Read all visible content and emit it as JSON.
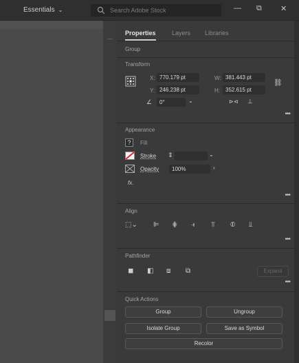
{
  "topbar": {
    "workspace_label": "Essentials",
    "search_placeholder": "Search Adobe Stock",
    "minimize": "—",
    "restore": "⧉",
    "close": "✕"
  },
  "panel": {
    "tabs": [
      "Properties",
      "Layers",
      "Libraries"
    ],
    "object_type": "Group",
    "transform": {
      "title": "Transform",
      "x_label": "X:",
      "x_value": "770.179 pt",
      "y_label": "Y:",
      "y_value": "246.238 pt",
      "w_label": "W:",
      "w_value": "381.443 pt",
      "h_label": "H:",
      "h_value": "352.615 pt",
      "angle_value": "0°"
    },
    "appearance": {
      "title": "Appearance",
      "fill_label": "Fill",
      "stroke_label": "Stroke",
      "opacity_label": "Opacity",
      "opacity_value": "100%",
      "fx_label": "fx."
    },
    "align": {
      "title": "Align"
    },
    "pathfinder": {
      "title": "Pathfinder",
      "expand_label": "Expand"
    },
    "quick_actions": {
      "title": "Quick Actions",
      "group": "Group",
      "ungroup": "Ungroup",
      "isolate": "Isolate Group",
      "save_symbol": "Save as Symbol",
      "recolor": "Recolor"
    }
  }
}
